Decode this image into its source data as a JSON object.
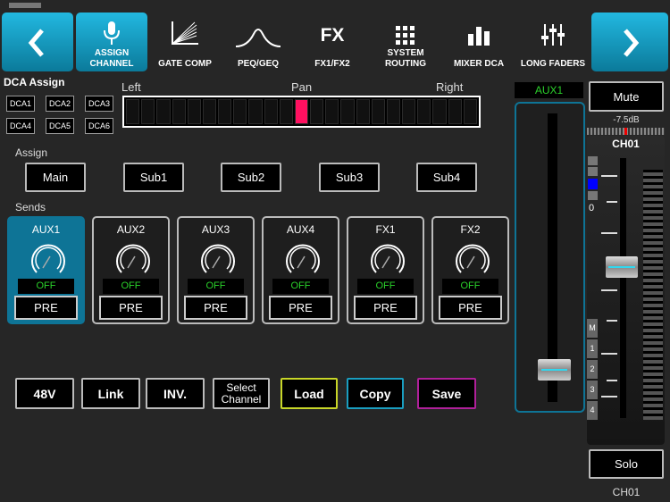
{
  "nav": {
    "back_icon": "chevron-left-icon",
    "forward_icon": "chevron-right-icon",
    "tabs": [
      {
        "label1": "ASSIGN",
        "label2": "CHANNEL",
        "icon": "microphone-icon"
      },
      {
        "label1": "",
        "label2": "GATE COMP",
        "icon": "gate-comp-icon"
      },
      {
        "label1": "",
        "label2": "PEQ/GEQ",
        "icon": "eq-curve-icon"
      },
      {
        "label1": "",
        "label2": "FX1/FX2",
        "icon": "fx-icon",
        "icon_text": "FX"
      },
      {
        "label1": "SYSTEM",
        "label2": "ROUTING",
        "icon": "grid-icon"
      },
      {
        "label1": "",
        "label2": "MIXER DCA",
        "icon": "bars-icon"
      },
      {
        "label1": "",
        "label2": "LONG FADERS",
        "icon": "faders-icon"
      }
    ]
  },
  "dca": {
    "title": "DCA Assign",
    "buttons": [
      "DCA1",
      "DCA2",
      "DCA3",
      "DCA4",
      "DCA5",
      "DCA6"
    ]
  },
  "pan": {
    "left": "Left",
    "center": "Pan",
    "right": "Right",
    "value": 0.5,
    "color": "#ff1060"
  },
  "assign": {
    "title": "Assign",
    "buttons": [
      "Main",
      "Sub1",
      "Sub2",
      "Sub3",
      "Sub4"
    ]
  },
  "sends": {
    "title": "Sends",
    "items": [
      {
        "name": "AUX1",
        "state": "OFF",
        "mode": "PRE",
        "selected": true
      },
      {
        "name": "AUX2",
        "state": "OFF",
        "mode": "PRE"
      },
      {
        "name": "AUX3",
        "state": "OFF",
        "mode": "PRE"
      },
      {
        "name": "AUX4",
        "state": "OFF",
        "mode": "PRE"
      },
      {
        "name": "FX1",
        "state": "OFF",
        "mode": "PRE"
      },
      {
        "name": "FX2",
        "state": "OFF",
        "mode": "PRE"
      }
    ]
  },
  "bottom": {
    "b48v": "48V",
    "link": "Link",
    "inv": "INV.",
    "select1": "Select",
    "select2": "Channel",
    "load": "Load",
    "copy": "Copy",
    "save": "Save"
  },
  "aux_fader": {
    "label": "AUX1",
    "value": 0.08
  },
  "channel": {
    "mute": "Mute",
    "gain": "-7.5dB",
    "name": "CH01",
    "zero": "0",
    "groups": [
      "M",
      "1",
      "2",
      "3",
      "4"
    ],
    "solo": "Solo",
    "footer": "CH01",
    "fader_value": 0.58
  },
  "colors": {
    "accent": "#0e7496",
    "load": "#c8d628",
    "copy": "#1a9ec0",
    "save": "#b0209a",
    "on": "#2bd12b"
  }
}
